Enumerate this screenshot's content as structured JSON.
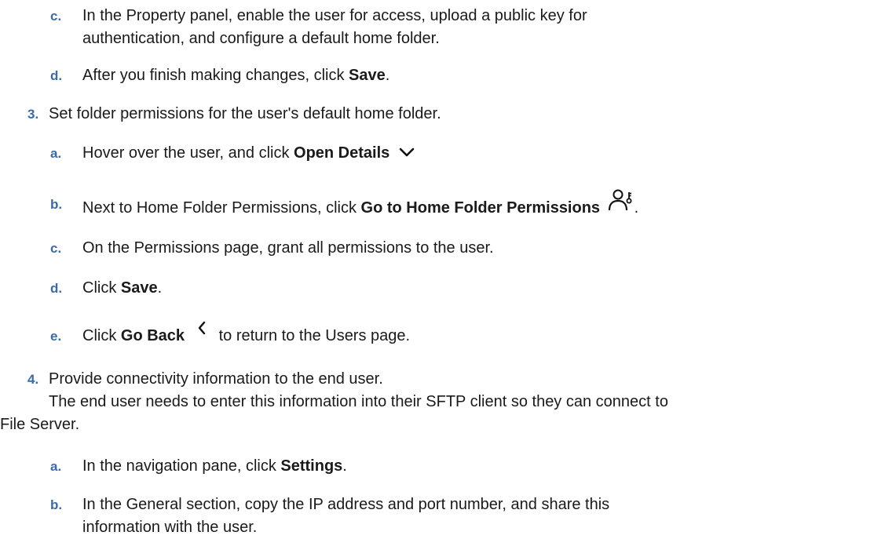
{
  "steps": {
    "s2c": {
      "marker": "c.",
      "line1": "In the Property panel, enable the user for access, upload a public key for",
      "line2": "authentication, and configure a default home folder."
    },
    "s2d": {
      "marker": "d.",
      "pre": "After you finish making changes, click ",
      "bold": "Save",
      "post": "."
    },
    "s3": {
      "marker": "3.",
      "text": "Set folder permissions for the user's default home folder."
    },
    "s3a": {
      "marker": "a.",
      "pre": "Hover over the user, and click ",
      "bold": "Open Details"
    },
    "s3b": {
      "marker": "b.",
      "pre": "Next to Home Folder Permissions, click ",
      "bold": "Go to Home Folder Permissions",
      "post": "."
    },
    "s3c": {
      "marker": "c.",
      "text": "On the Permissions page, grant all permissions to the user."
    },
    "s3d": {
      "marker": "d.",
      "pre": "Click ",
      "bold": "Save",
      "post": "."
    },
    "s3e": {
      "marker": "e.",
      "pre": "Click ",
      "bold": "Go Back",
      "post": "to return to the Users page."
    },
    "s4": {
      "marker": "4.",
      "line1": "Provide connectivity information to the end user.",
      "line2": "The end user needs to enter this information into their SFTP client so they can connect to",
      "line3": "File Server."
    },
    "s4a": {
      "marker": "a.",
      "pre": "In the navigation pane, click ",
      "bold": "Settings",
      "post": "."
    },
    "s4b": {
      "marker": "b.",
      "line1": "In the General section, copy the IP address and port number, and share this",
      "line2": "information with the user."
    }
  },
  "icons": {
    "open_details": "chevron-down-icon",
    "home_folder_permissions": "user-key-icon",
    "go_back": "chevron-left-icon"
  }
}
